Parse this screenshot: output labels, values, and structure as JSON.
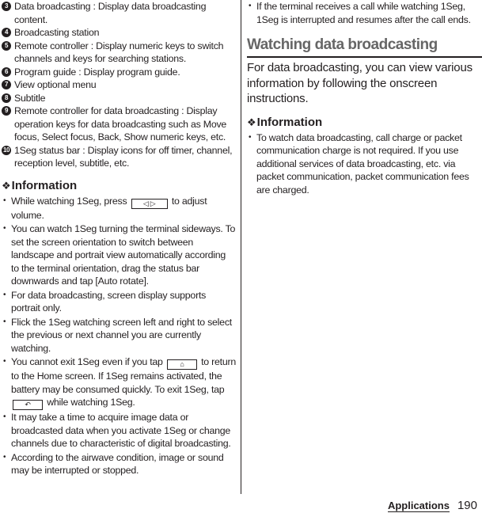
{
  "left_column": {
    "numbered_items": [
      {
        "marker": "3",
        "text": "Data broadcasting : Display data broadcasting content."
      },
      {
        "marker": "4",
        "text": "Broadcasting station"
      },
      {
        "marker": "5",
        "text": "Remote controller : Display numeric keys to switch channels and keys for searching stations."
      },
      {
        "marker": "6",
        "text": "Program guide : Display program guide."
      },
      {
        "marker": "7",
        "text": "View optional menu"
      },
      {
        "marker": "8",
        "text": "Subtitle"
      },
      {
        "marker": "9",
        "text": "Remote controller for data broadcasting : Display operation keys for data broadcasting such as Move focus, Select focus, Back, Show numeric keys, etc."
      },
      {
        "marker": "10",
        "text": "1Seg status bar : Display icons for off timer, channel, reception level, subtitle, etc."
      }
    ],
    "information": {
      "heading_icon": "❖",
      "heading": "Information",
      "bullets": {
        "b1_before": "While watching 1Seg, press",
        "b1_key": "◁  ▷",
        "b1_after": "to adjust volume.",
        "b2": "You can watch 1Seg turning the terminal sideways. To set the screen orientation to switch between landscape and portrait view automatically according to the terminal orientation, drag the status bar downwards and tap [Auto rotate].",
        "b3": "For data broadcasting, screen display supports portrait only.",
        "b4": "Flick the 1Seg watching screen left and right to select the previous or next channel you are currently watching.",
        "b5_before": "You cannot exit 1Seg even if you tap",
        "b5_key1": "⌂",
        "b5_mid": "to return to the Home screen. If 1Seg remains activated, the battery may be consumed quickly. To exit 1Seg, tap",
        "b5_key2": "↶",
        "b5_after": "while watching 1Seg.",
        "b6": "It may take a time to acquire image data or broadcasted data when you activate 1Seg or change channels due to characteristic of digital broadcasting.",
        "b7": "According to the airwave condition, image or sound may be interrupted or stopped."
      }
    }
  },
  "right_column": {
    "top_bullet": "If the terminal receives a call while watching 1Seg, 1Seg is interrupted and resumes after the call ends.",
    "section_title": "Watching data broadcasting",
    "lead": "For data broadcasting, you can view various information by following the onscreen instructions.",
    "information": {
      "heading_icon": "❖",
      "heading": "Information",
      "bullets": [
        "To watch data broadcasting, call charge or packet communication charge is not required. If you use additional services of data broadcasting, etc. via packet communication, packet communication fees are charged."
      ]
    }
  },
  "footer": {
    "section": "Applications",
    "page_number": "190"
  }
}
